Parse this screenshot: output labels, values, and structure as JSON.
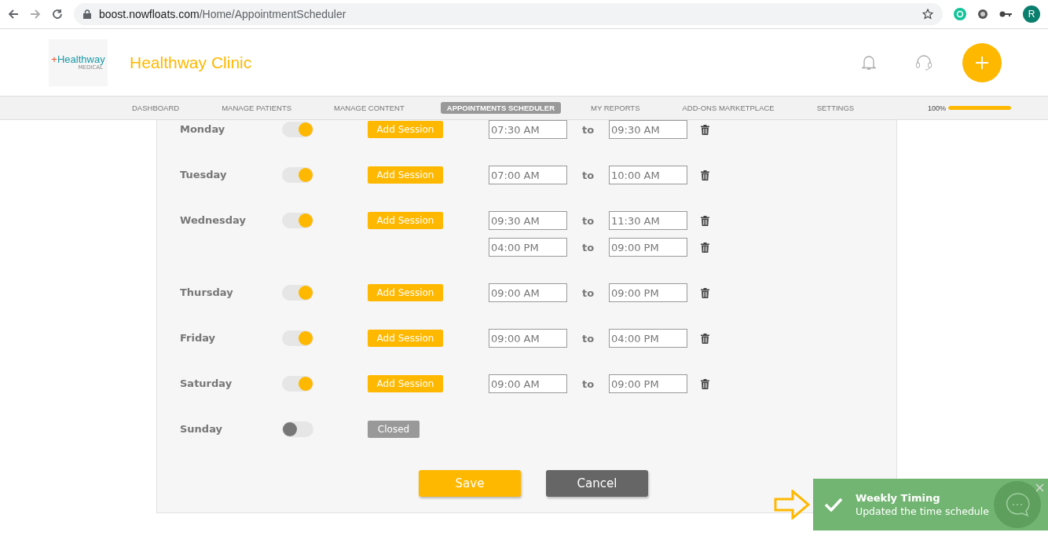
{
  "browser": {
    "url_host": "boost.nowfloats.com",
    "url_path": "/Home/AppointmentScheduler",
    "profile_initial": "R"
  },
  "header": {
    "logo_mark": "+",
    "logo_text": "Healthway",
    "logo_subtext": "MEDICAL",
    "clinic_name": "Healthway Clinic"
  },
  "nav": {
    "items": [
      {
        "label": "DASHBOARD",
        "selected": false
      },
      {
        "label": "MANAGE PATIENTS",
        "selected": false
      },
      {
        "label": "MANAGE CONTENT",
        "selected": false
      },
      {
        "label": "APPOINTMENTS SCHEDULER",
        "selected": true
      },
      {
        "label": "MY REPORTS",
        "selected": false
      },
      {
        "label": "ADD-ONS MARKETPLACE",
        "selected": false
      },
      {
        "label": "SETTINGS",
        "selected": false
      }
    ],
    "progress": {
      "reading": "100%",
      "level": 1
    }
  },
  "schedule": {
    "days": [
      {
        "day": "Monday",
        "on": true,
        "action": "Add Session",
        "sessions": [
          {
            "from": "07:30 AM",
            "sep": "to",
            "to": "09:30 AM"
          }
        ]
      },
      {
        "day": "Tuesday",
        "on": true,
        "action": "Add Session",
        "sessions": [
          {
            "from": "07:00 AM",
            "sep": "to",
            "to": "10:00 AM"
          }
        ]
      },
      {
        "day": "Wednesday",
        "on": true,
        "action": "Add Session",
        "sessions": [
          {
            "from": "09:30 AM",
            "sep": "to",
            "to": "11:30 AM"
          },
          {
            "from": "04:00 PM",
            "sep": "to",
            "to": "09:00 PM"
          }
        ]
      },
      {
        "day": "Thursday",
        "on": true,
        "action": "Add Session",
        "sessions": [
          {
            "from": "09:00 AM",
            "sep": "to",
            "to": "09:00 PM"
          }
        ]
      },
      {
        "day": "Friday",
        "on": true,
        "action": "Add Session",
        "sessions": [
          {
            "from": "09:00 AM",
            "sep": "to",
            "to": "04:00 PM"
          }
        ]
      },
      {
        "day": "Saturday",
        "on": true,
        "action": "Add Session",
        "sessions": [
          {
            "from": "09:00 AM",
            "sep": "to",
            "to": "09:00 PM"
          }
        ]
      },
      {
        "day": "Sunday",
        "on": false,
        "action": "Closed"
      }
    ],
    "buttons": [
      {
        "label": "Save",
        "kind": "primary"
      },
      {
        "label": "Cancel",
        "kind": "secondary"
      }
    ]
  },
  "toast": {
    "title": "Weekly Timing",
    "message": "Updated the time schedule"
  }
}
